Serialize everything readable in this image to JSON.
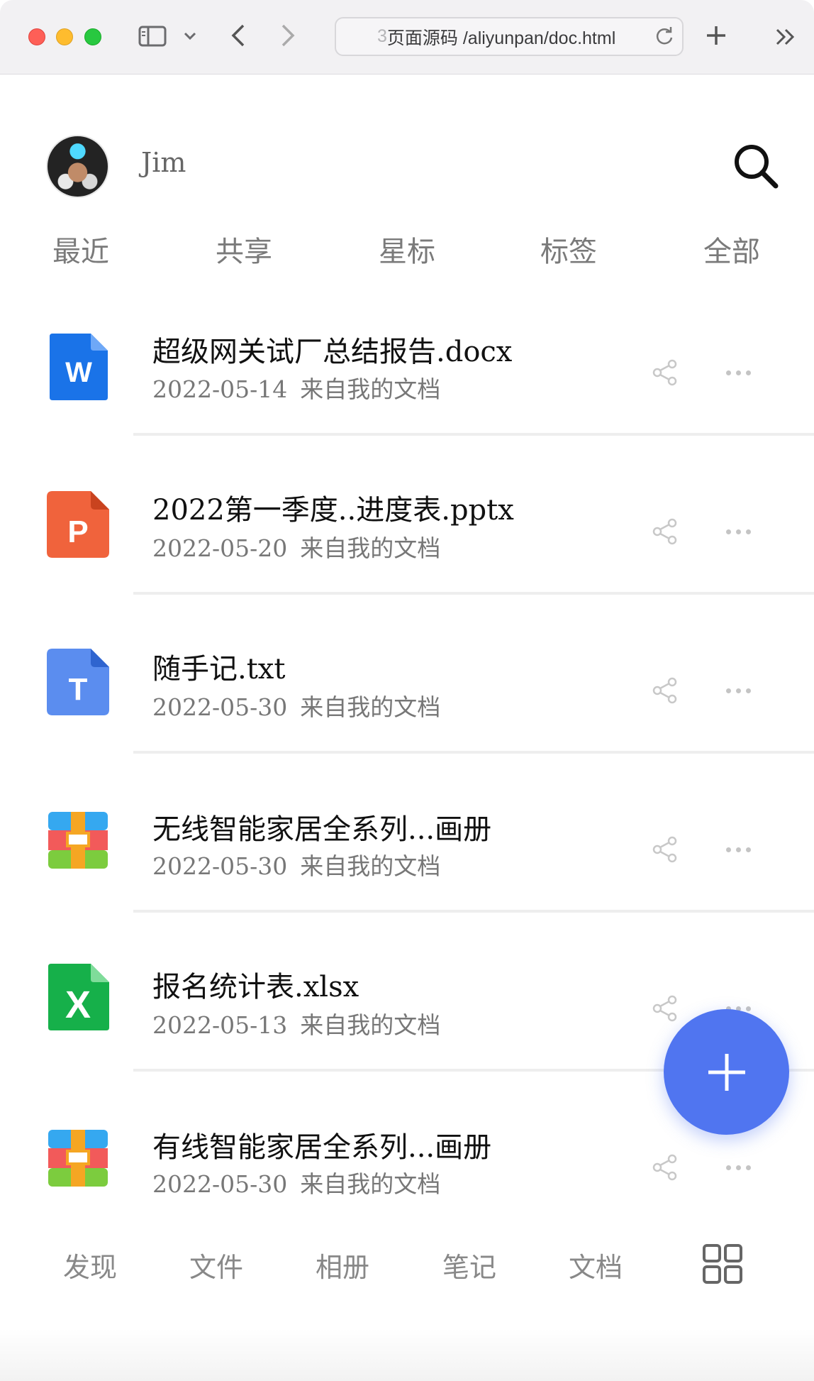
{
  "browser": {
    "url_prefix": "3",
    "url_text": "页面源码 /aliyunpan/doc.html"
  },
  "header": {
    "username": "Jim"
  },
  "tabs": [
    {
      "label": "最近"
    },
    {
      "label": "共享"
    },
    {
      "label": "星标"
    },
    {
      "label": "标签"
    },
    {
      "label": "全部"
    }
  ],
  "files": [
    {
      "name": "超级网关试厂总结报告.docx",
      "date": "2022-05-14",
      "source": "来自我的文档",
      "icon": "word-file-icon",
      "icon_letter": "W",
      "color": "#1a73e8"
    },
    {
      "name": "2022第一季度..进度表.pptx",
      "date": "2022-05-20",
      "source": "来自我的文档",
      "icon": "ppt-file-icon",
      "icon_letter": "P",
      "color": "#f0633c"
    },
    {
      "name": "随手记.txt",
      "date": "2022-05-30",
      "source": "来自我的文档",
      "icon": "text-file-icon",
      "icon_letter": "T",
      "color": "#5b8def"
    },
    {
      "name": "无线智能家居全系列...画册",
      "date": "2022-05-30",
      "source": "来自我的文档",
      "icon": "archive-file-icon",
      "icon_letter": "",
      "color": "#f5a623"
    },
    {
      "name": "报名统计表.xlsx",
      "date": "2022-05-13",
      "source": "来自我的文档",
      "icon": "excel-file-icon",
      "icon_letter": "X",
      "color": "#16b04a"
    },
    {
      "name": "有线智能家居全系列...画册",
      "date": "2022-05-30",
      "source": "来自我的文档",
      "icon": "archive-file-icon",
      "icon_letter": "",
      "color": "#f5a623"
    }
  ],
  "bottom_nav": [
    {
      "label": "发现"
    },
    {
      "label": "文件"
    },
    {
      "label": "相册"
    },
    {
      "label": "笔记"
    },
    {
      "label": "文档"
    }
  ],
  "accent_color": "#5075f0"
}
